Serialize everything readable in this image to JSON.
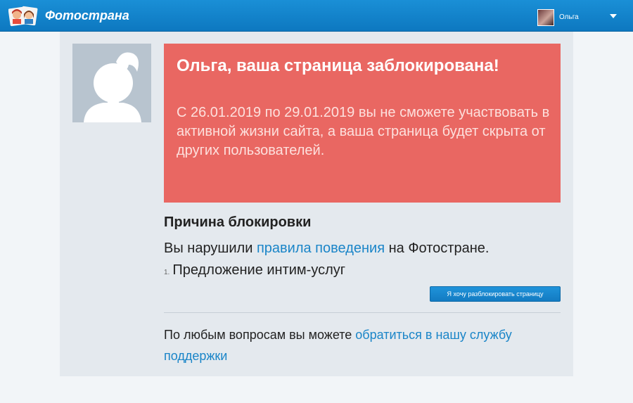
{
  "header": {
    "brand": "Фотострана",
    "user_name": "Ольга"
  },
  "notice": {
    "title": "Ольга, ваша страница заблокирована!",
    "text": "С 26.01.2019 по 29.01.2019 вы не сможете участвовать в активной жизни сайта, а ваша страница будет скрыта от других пользователей."
  },
  "reason": {
    "title": "Причина блокировки",
    "prefix": "Вы нарушили ",
    "rules_link": "правила поведения",
    "suffix": " на Фотостране.",
    "item_number": "1.",
    "item_text": "Предложение интим-услуг"
  },
  "unblock_button": "Я хочу разблокировать страницу",
  "support": {
    "prefix": "По любым вопросам вы можете ",
    "link": "обратиться в нашу службу поддержки"
  },
  "colors": {
    "header": "#0d78c0",
    "banner": "#e96762",
    "link": "#1a85c8",
    "card": "#e4e9ee"
  }
}
